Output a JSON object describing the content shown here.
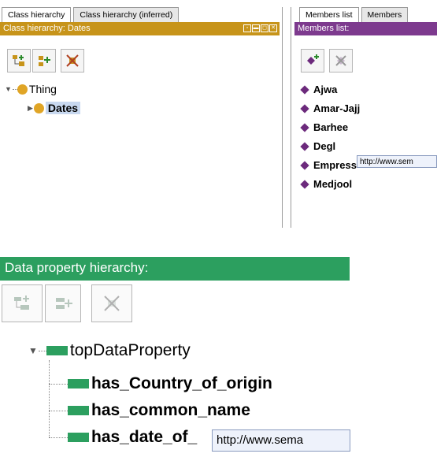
{
  "class_tabs": [
    "Class hierarchy",
    "Class hierarchy (inferred)"
  ],
  "member_tabs": [
    "Members list",
    "Members"
  ],
  "class_panel": {
    "title": "Class hierarchy: Dates",
    "root": "Thing",
    "child": "Dates"
  },
  "members_panel": {
    "title": "Members list:",
    "items": [
      "Ajwa",
      "Amar-Jajj",
      "Barhee",
      "Degl",
      "Empress",
      "Medjool"
    ],
    "tooltip": "http://www.sem"
  },
  "data_property_panel": {
    "title": "Data property hierarchy:",
    "root": "topDataProperty",
    "children": [
      "has_Country_of_origin",
      "has_common_name",
      "has_date_of_"
    ],
    "tooltip": "http://www.sema"
  },
  "icons": {
    "add_subclass": "add-subclass-icon",
    "add_sibling": "add-sibling-class-icon",
    "delete_class": "delete-class-icon",
    "add_individual": "add-individual-icon",
    "delete_individual": "delete-individual-icon",
    "add_sub_property": "add-sub-property-icon",
    "add_sibling_property": "add-sibling-property-icon",
    "delete_property": "delete-property-icon"
  },
  "colors": {
    "class_header": "#c7941a",
    "members_header": "#7d3a8e",
    "data_property_header": "#2c9f5f",
    "selection": "#c8d8ef"
  }
}
